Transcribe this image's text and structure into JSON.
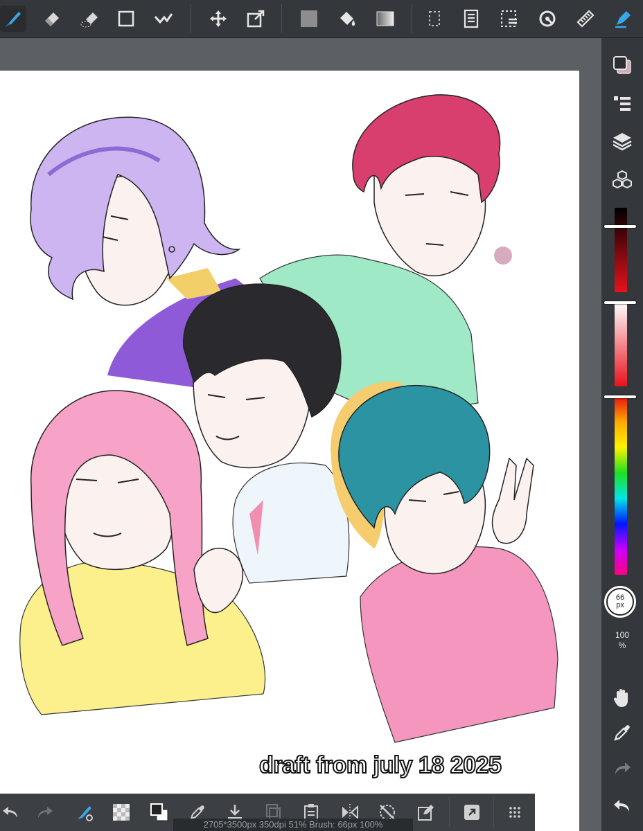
{
  "toolbar": {
    "tools": [
      {
        "name": "brush-tool",
        "active": true
      },
      {
        "name": "eraser-tool"
      },
      {
        "name": "blur-tool"
      },
      {
        "name": "shape-tool"
      },
      {
        "name": "correction-tool"
      },
      {
        "name": "move-tool"
      },
      {
        "name": "transform-tool"
      },
      {
        "name": "fill-color"
      },
      {
        "name": "bucket-tool"
      },
      {
        "name": "gradient-tool"
      },
      {
        "name": "select-tool"
      },
      {
        "name": "text-tool"
      },
      {
        "name": "lasso-select-tool"
      },
      {
        "name": "rotate-tool"
      },
      {
        "name": "ruler-tool"
      },
      {
        "name": "pen-tool"
      }
    ]
  },
  "sidebar": {
    "brush_size_value": "66",
    "brush_size_unit": "px",
    "opacity_value": "100",
    "opacity_unit": "%",
    "colors": {
      "accent": "#3aa8e8",
      "current_color": "#e83a44"
    }
  },
  "canvas": {
    "watermark_text": "draft from july 18 2025"
  },
  "statusbar": {
    "text": "2705*3500px 350dpi 51% Brush: 66px 100%"
  }
}
